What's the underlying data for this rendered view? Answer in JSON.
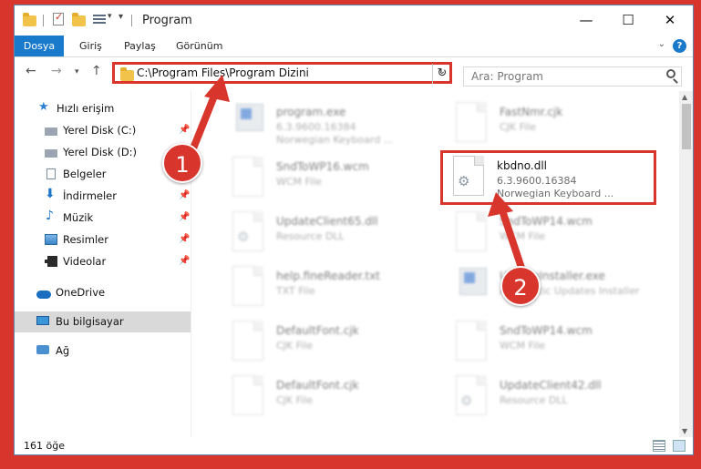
{
  "window": {
    "title": "Program",
    "controls": {
      "minimize": "—",
      "maximize": "☐",
      "close": "✕"
    }
  },
  "ribbon": {
    "file_tab": "Dosya",
    "tabs": [
      "Giriş",
      "Paylaş",
      "Görünüm"
    ],
    "help": "?"
  },
  "address": {
    "path": "C:\\Program Files\\Program Dizini",
    "search_placeholder": "Ara: Program"
  },
  "sidebar": {
    "items": [
      {
        "label": "Hızlı erişim",
        "icon": "star-icon"
      },
      {
        "label": "Yerel Disk (C:)",
        "icon": "disk-icon",
        "pinned": true
      },
      {
        "label": "Yerel Disk (D:)",
        "icon": "disk-icon",
        "pinned": true
      },
      {
        "label": "Belgeler",
        "icon": "document-icon",
        "pinned": true
      },
      {
        "label": "İndirmeler",
        "icon": "download-icon",
        "pinned": true
      },
      {
        "label": "Müzik",
        "icon": "music-icon",
        "pinned": true
      },
      {
        "label": "Resimler",
        "icon": "pictures-icon",
        "pinned": true
      },
      {
        "label": "Videolar",
        "icon": "videos-icon",
        "pinned": true
      },
      {
        "label": "OneDrive",
        "icon": "cloud-icon"
      },
      {
        "label": "Bu bilgisayar",
        "icon": "computer-icon",
        "selected": true
      },
      {
        "label": "Ağ",
        "icon": "network-icon"
      }
    ]
  },
  "files": [
    {
      "name": "program.exe",
      "line1": "6.3.9600.16384",
      "line2": "Norwegian Keyboard ...",
      "icon": "exe-icon"
    },
    {
      "name": "FastNmr.cjk",
      "line1": "CJK File",
      "line2": "",
      "icon": "file-icon"
    },
    {
      "name": "SndToWP16.wcm",
      "line1": "WCM File",
      "line2": "",
      "icon": "file-icon"
    },
    {
      "name": "kbdno.dll",
      "line1": "6.3.9600.16384",
      "line2": "Norwegian Keyboard ...",
      "icon": "dll-icon",
      "highlighted": true
    },
    {
      "name": "UpdateClient65.dll",
      "line1": "Resource DLL",
      "line2": "",
      "icon": "dll-icon"
    },
    {
      "name": "SndToWP14.wcm",
      "line1": "WCM File",
      "line2": "",
      "icon": "file-icon"
    },
    {
      "name": "help.fineReader.txt",
      "line1": "TXT File",
      "line2": "",
      "icon": "file-icon"
    },
    {
      "name": "UpdateInstaller.exe",
      "line1": "Automatic Updates Installer",
      "line2": "",
      "icon": "exe-icon"
    },
    {
      "name": "DefaultFont.cjk",
      "line1": "CJK File",
      "line2": "",
      "icon": "file-icon"
    },
    {
      "name": "SndToWP14.wcm",
      "line1": "WCM File",
      "line2": "",
      "icon": "file-icon"
    },
    {
      "name": "DefaultFont.cjk",
      "line1": "CJK File",
      "line2": "",
      "icon": "file-icon"
    },
    {
      "name": "UpdateClient42.dll",
      "line1": "Resource DLL",
      "line2": "",
      "icon": "dll-icon"
    }
  ],
  "status": {
    "item_count": "161 öğe"
  },
  "callouts": [
    "1",
    "2"
  ],
  "colors": {
    "accent": "#1979ca",
    "callout": "#d8352c",
    "selection": "#d9d9d9"
  }
}
